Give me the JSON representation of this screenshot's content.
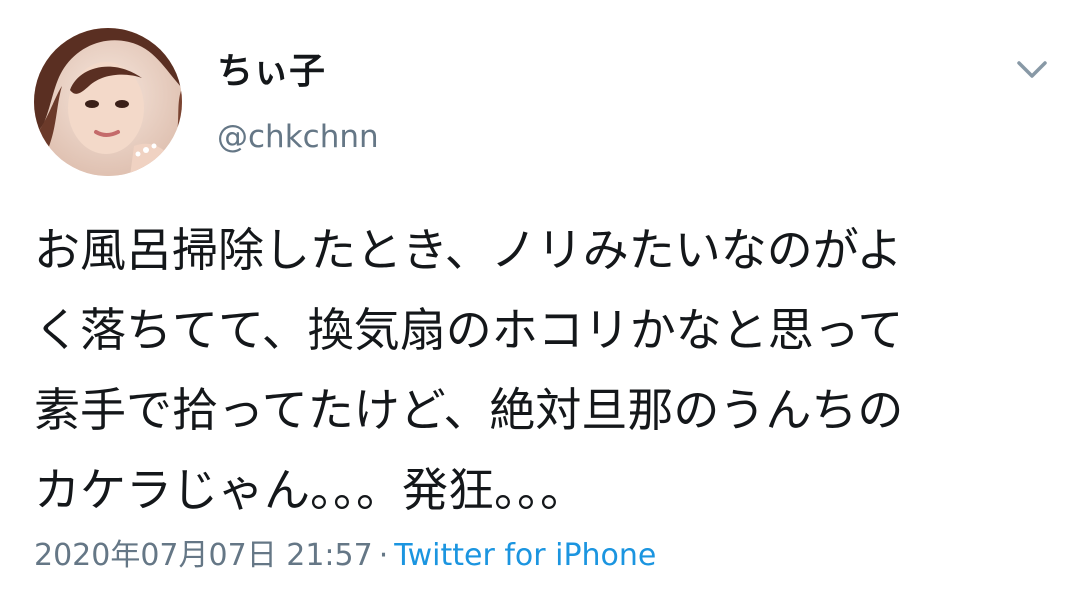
{
  "tweet": {
    "display_name": "ちぃ子",
    "handle": "@chkchnn",
    "text_lines": [
      "お風呂掃除したとき、ノリみたいなのがよ",
      "く落ちてて、換気扇のホコリかなと思って",
      "素手で拾ってたけど、絶対旦那のうんちの",
      "カケラじゃん。。。発狂。。。"
    ],
    "timestamp": "2020年07月07日 21:57",
    "separator": "·",
    "source": "Twitter for iPhone"
  },
  "icons": {
    "menu": "chevron-down-icon",
    "avatar": "avatar"
  },
  "colors": {
    "text": "#14171a",
    "secondary": "#657786",
    "link": "#1b95e0",
    "background": "#ffffff"
  }
}
